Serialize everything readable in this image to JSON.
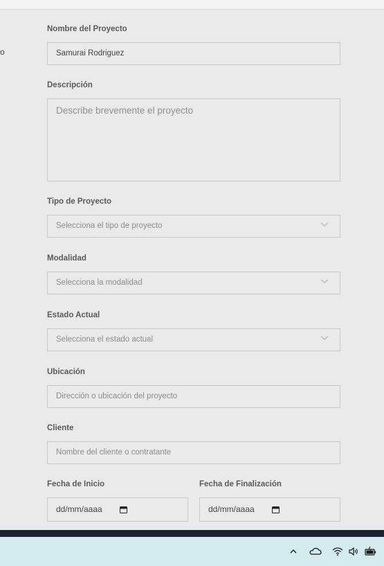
{
  "clipped_left_text": "o",
  "form": {
    "project_name": {
      "label": "Nombre del Proyecto",
      "value": "Samurai Rodriguez"
    },
    "description": {
      "label": "Descripción",
      "placeholder": "Describe brevemente el proyecto"
    },
    "project_type": {
      "label": "Tipo de Proyecto",
      "selected": "Selecciona el tipo de proyecto"
    },
    "modality": {
      "label": "Modalidad",
      "selected": "Selecciona la modalidad"
    },
    "status": {
      "label": "Estado Actual",
      "selected": "Selecciona el estado actual"
    },
    "location": {
      "label": "Ubicación",
      "placeholder": "Dirección o ubicación del proyecto"
    },
    "client": {
      "label": "Cliente",
      "placeholder": "Nombre del cliente o contratante"
    },
    "start_date": {
      "label": "Fecha de Inicio",
      "placeholder": "dd/mm/aaaa",
      "icon": "calendar-icon"
    },
    "end_date": {
      "label": "Fecha de Finalización",
      "placeholder": "dd/mm/aaaa",
      "icon": "calendar-icon"
    }
  },
  "taskbar": {
    "icons": [
      "chevron-up-icon",
      "onedrive-cloud-icon",
      "wifi-icon",
      "speaker-icon",
      "battery-icon"
    ]
  },
  "colors": {
    "page_background": "#eaeaea",
    "field_border": "#c7c7c7",
    "label_text": "#5a5a5a",
    "placeholder_text": "#8c8c8c",
    "taskbar_background": "#d3eaee",
    "dark_band": "#1c2233"
  }
}
